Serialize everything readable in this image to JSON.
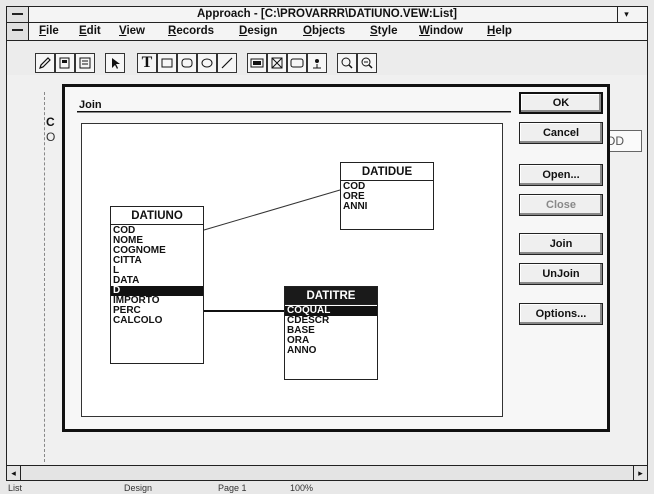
{
  "window": {
    "title": "Approach - [C:\\PROVARRR\\DATIUNO.VEW:List]",
    "scroll_arrow": "▾"
  },
  "menu": [
    "File",
    "Edit",
    "View",
    "Records",
    "Design",
    "Objects",
    "Style",
    "Window",
    "Help"
  ],
  "background": {
    "field_text": "OD",
    "c_letter": "C",
    "c_letter2": "O"
  },
  "dialog": {
    "title": "Join",
    "buttons": {
      "ok": "OK",
      "cancel": "Cancel",
      "open": "Open...",
      "close": "Close",
      "join": "Join",
      "unjoin": "UnJoin",
      "options": "Options..."
    },
    "tables": [
      {
        "name": "DATIUNO",
        "header_selected": false,
        "fields": [
          "COD",
          "NOME",
          "COGNOME",
          "CITTA",
          "L",
          "DATA",
          "D",
          "IMPORTO",
          "PERC",
          "CALCOLO"
        ],
        "selected_field": "D"
      },
      {
        "name": "DATIDUE",
        "header_selected": false,
        "fields": [
          "COD",
          "ORE",
          "ANNI"
        ],
        "selected_field": null
      },
      {
        "name": "DATITRE",
        "header_selected": true,
        "fields": [
          "COQUAL",
          "CDESCR",
          "BASE",
          "ORA",
          "ANNO"
        ],
        "selected_field": "COQUAL"
      }
    ]
  },
  "status": {
    "mode": "List",
    "design": "Design",
    "page": "Page 1",
    "zoom": "100%"
  }
}
